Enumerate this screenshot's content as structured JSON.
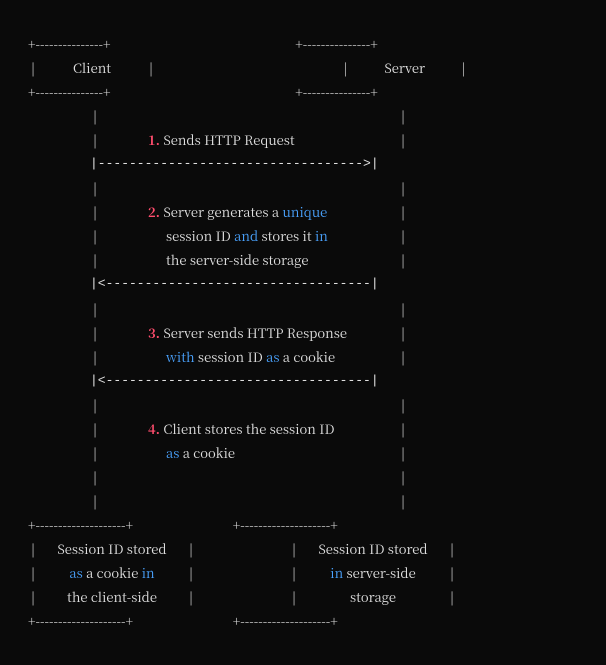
{
  "actors": {
    "client": "Client",
    "server": "Server"
  },
  "steps": [
    {
      "n": "1.",
      "text_parts": [
        {
          "t": "Sends HTTP Request",
          "c": "white"
        }
      ]
    },
    {
      "n": "2.",
      "text_parts": [
        {
          "t": "Server generates a ",
          "c": "white"
        },
        {
          "t": "unique",
          "c": "blue"
        }
      ],
      "cont": [
        [
          {
            "t": "session ID ",
            "c": "white"
          },
          {
            "t": "and",
            "c": "blue"
          },
          {
            "t": " stores it ",
            "c": "white"
          },
          {
            "t": "in",
            "c": "blue"
          }
        ],
        [
          {
            "t": "the server-side storage",
            "c": "white"
          }
        ]
      ]
    },
    {
      "n": "3.",
      "text_parts": [
        {
          "t": "Server sends HTTP Response",
          "c": "white"
        }
      ],
      "cont": [
        [
          {
            "t": "with",
            "c": "blue"
          },
          {
            "t": " session ID ",
            "c": "white"
          },
          {
            "t": "as",
            "c": "blue"
          },
          {
            "t": " a cookie",
            "c": "white"
          }
        ]
      ]
    },
    {
      "n": "4.",
      "text_parts": [
        {
          "t": "Client stores the session ID",
          "c": "white"
        }
      ],
      "cont": [
        [
          {
            "t": "as",
            "c": "blue"
          },
          {
            "t": " a cookie",
            "c": "white"
          }
        ]
      ]
    }
  ],
  "footers": {
    "client": [
      [
        {
          "t": "Session ID stored",
          "c": "white"
        }
      ],
      [
        {
          "t": "as",
          "c": "blue"
        },
        {
          "t": " a cookie ",
          "c": "white"
        },
        {
          "t": "in",
          "c": "blue"
        }
      ],
      [
        {
          "t": "the client-side",
          "c": "white"
        }
      ]
    ],
    "server": [
      [
        {
          "t": "Session ID stored",
          "c": "white"
        }
      ],
      [
        {
          "t": "in",
          "c": "blue"
        },
        {
          "t": " server-side",
          "c": "white"
        }
      ],
      [
        {
          "t": "storage",
          "c": "white"
        }
      ]
    ]
  },
  "glyphs": {
    "corner": "+",
    "h": "-",
    "v": "|",
    "arrow_r": ">",
    "arrow_l": "<"
  }
}
